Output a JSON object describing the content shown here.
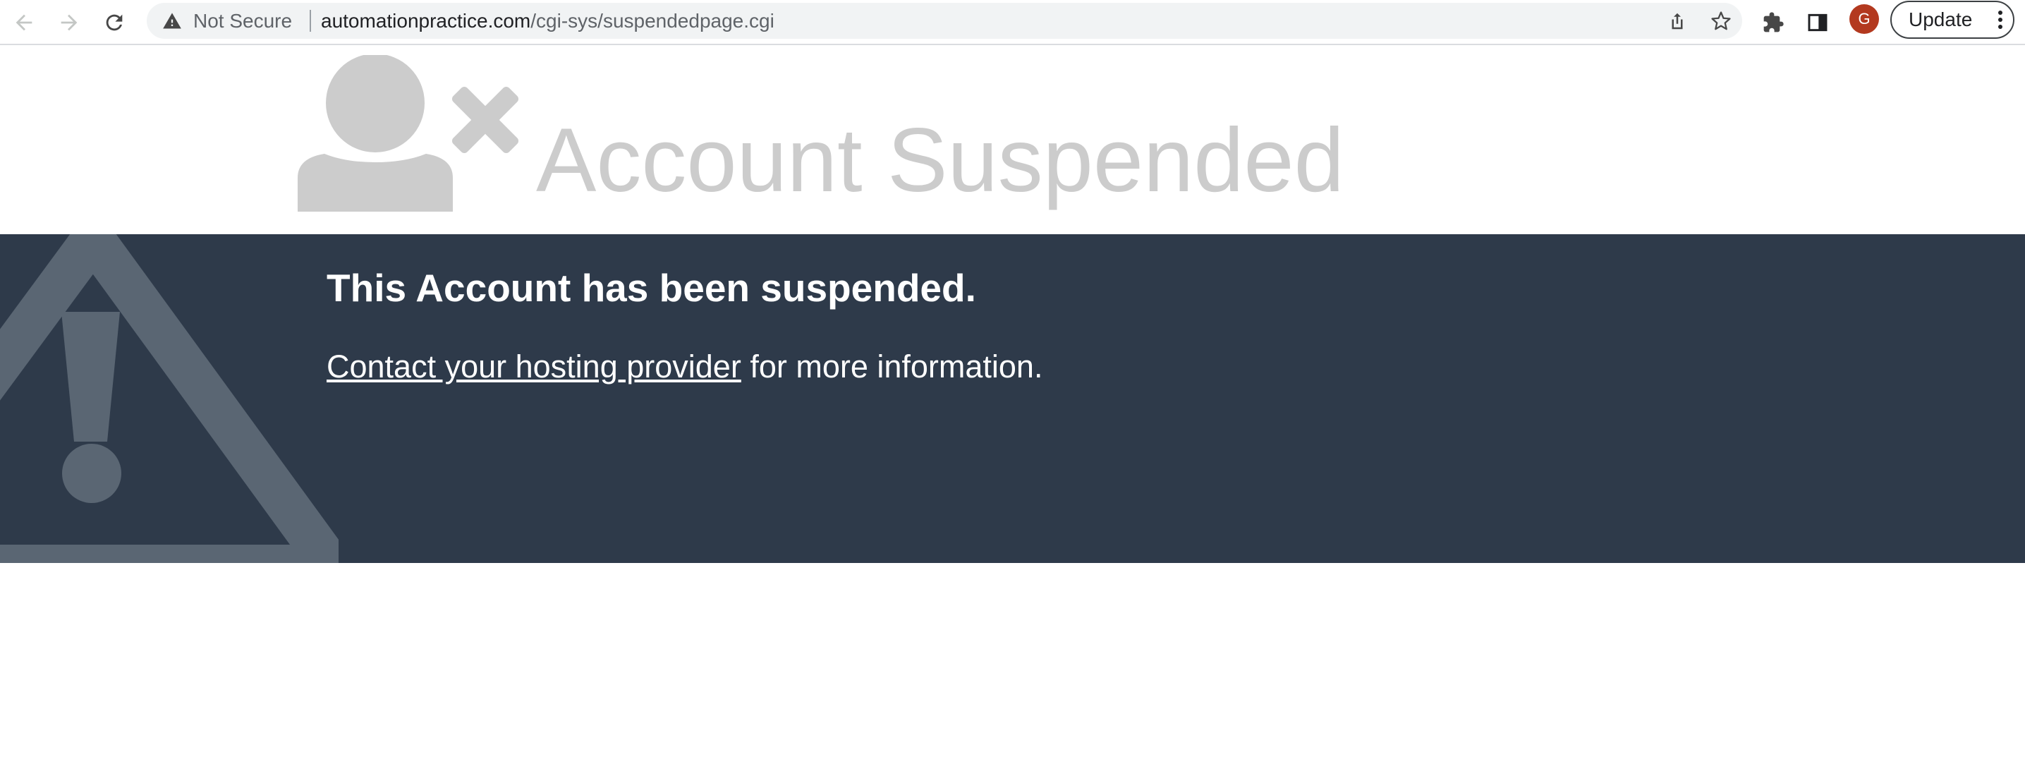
{
  "browser": {
    "security_label": "Not Secure",
    "url_host": "automationpractice.com",
    "url_path": "/cgi-sys/suspendedpage.cgi",
    "avatar_initial": "G",
    "update_label": "Update",
    "icons": {
      "back": "arrow-left-icon",
      "forward": "arrow-right-icon",
      "reload": "reload-icon",
      "warning": "warning-triangle-icon",
      "share": "share-icon",
      "bookmark": "star-icon",
      "extensions": "puzzle-icon",
      "side_panel": "side-panel-icon",
      "menu": "kebab-menu-icon"
    }
  },
  "page": {
    "title": "Account Suspended",
    "heading": "This Account has been suspended.",
    "contact_link": "Contact your hosting provider",
    "info_suffix": " for more information.",
    "colors": {
      "title": "#cccccc",
      "banner_bg": "#2e3a4a",
      "banner_text": "#ffffff",
      "warning_watermark": "#5a6673"
    }
  }
}
